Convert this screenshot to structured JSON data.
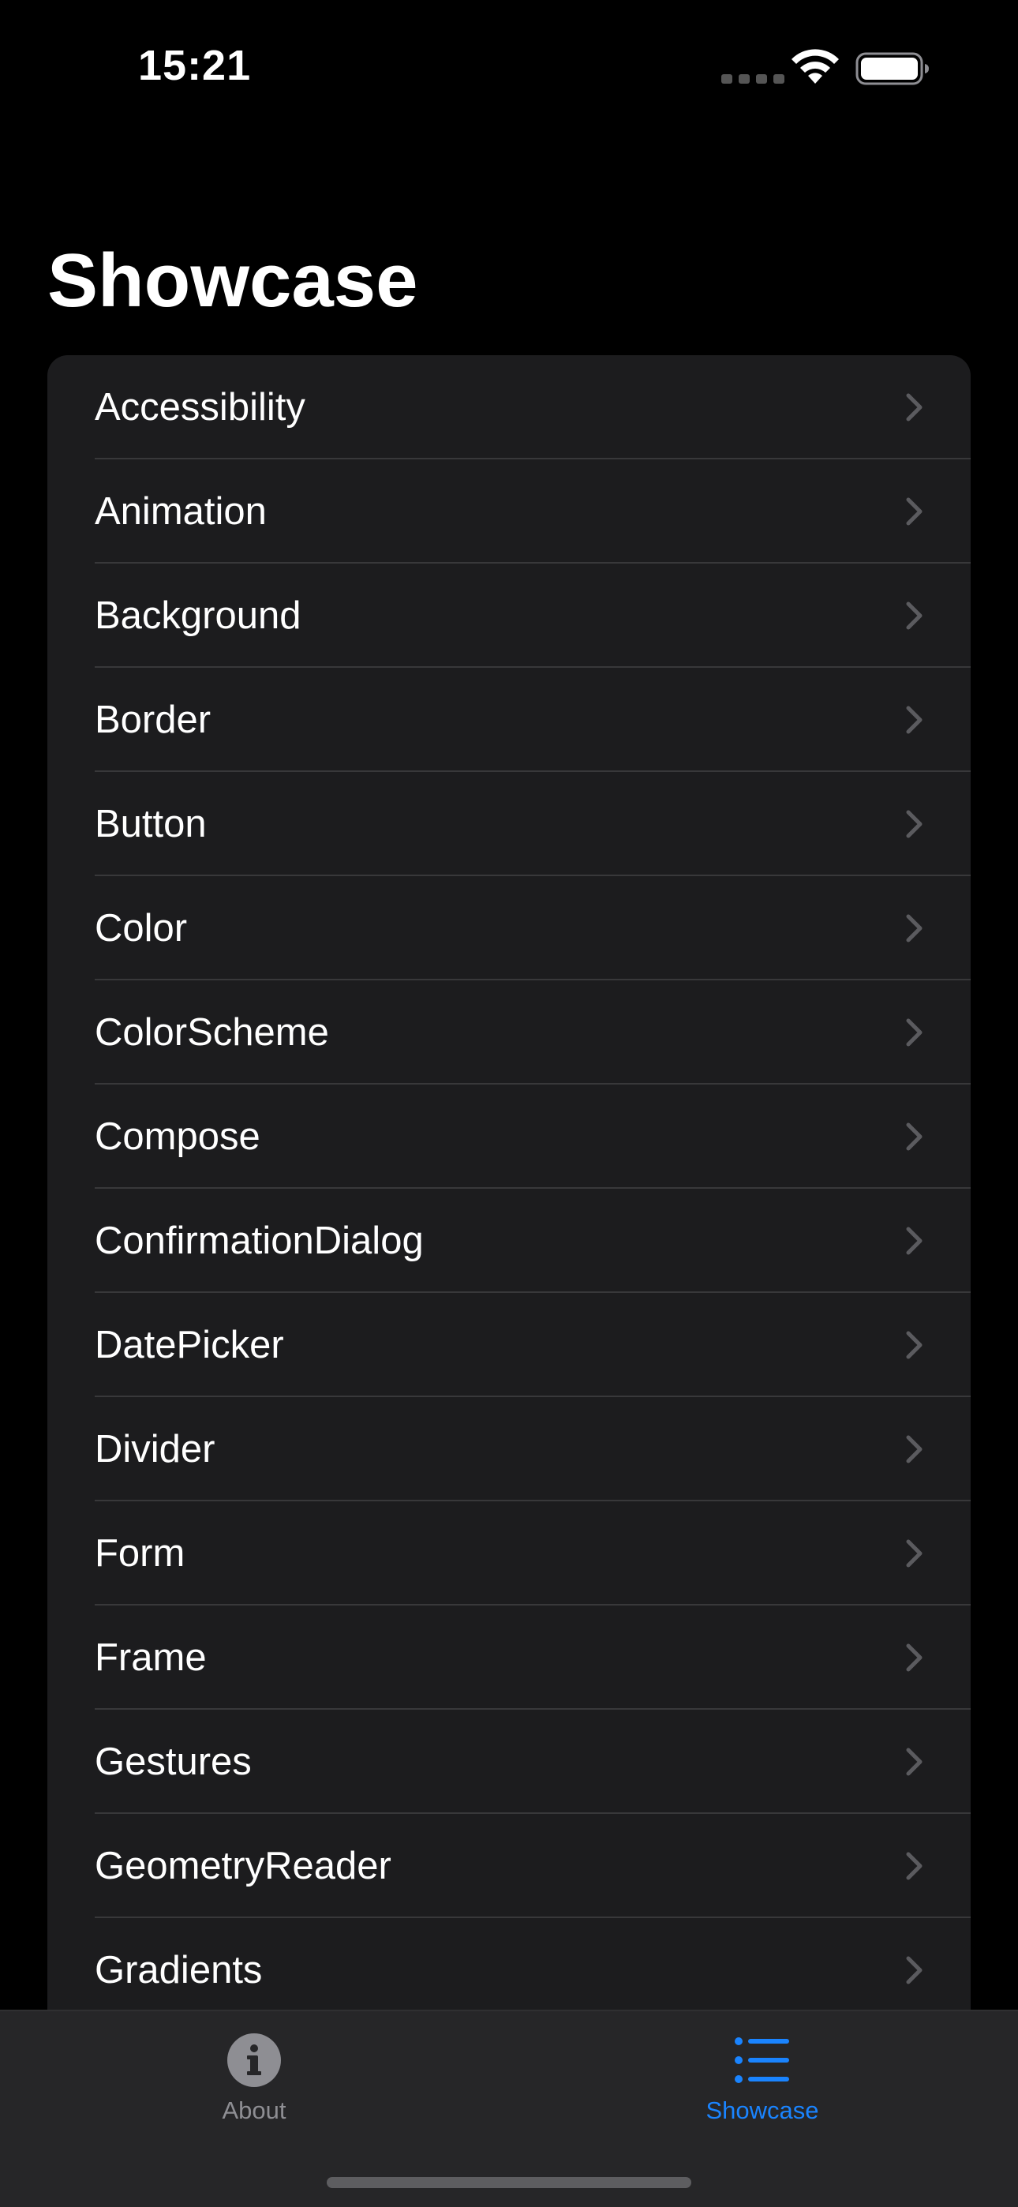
{
  "status_bar": {
    "time": "15:21"
  },
  "title": "Showcase",
  "items": [
    {
      "label": "Accessibility"
    },
    {
      "label": "Animation"
    },
    {
      "label": "Background"
    },
    {
      "label": "Border"
    },
    {
      "label": "Button"
    },
    {
      "label": "Color"
    },
    {
      "label": "ColorScheme"
    },
    {
      "label": "Compose"
    },
    {
      "label": "ConfirmationDialog"
    },
    {
      "label": "DatePicker"
    },
    {
      "label": "Divider"
    },
    {
      "label": "Form"
    },
    {
      "label": "Frame"
    },
    {
      "label": "Gestures"
    },
    {
      "label": "GeometryReader"
    },
    {
      "label": "Gradients"
    }
  ],
  "tab_bar": {
    "tabs": [
      {
        "label": "About",
        "icon": "info-circle-icon",
        "selected": false
      },
      {
        "label": "Showcase",
        "icon": "list-bullet-icon",
        "selected": true
      }
    ]
  },
  "colors": {
    "background": "#000000",
    "list_background": "#1c1c1e",
    "accent": "#1a84ff",
    "inactive": "#8e8e93"
  }
}
